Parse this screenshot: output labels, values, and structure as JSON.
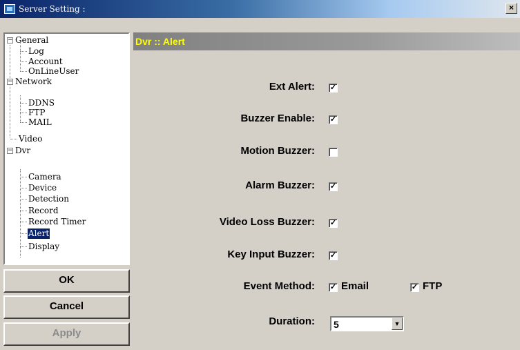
{
  "window": {
    "title": "Server Setting :",
    "close_label": "×"
  },
  "tree": {
    "nodes": {
      "general": {
        "label": "General",
        "expander": "−"
      },
      "log": {
        "label": "Log"
      },
      "account": {
        "label": "Account"
      },
      "onlineuser": {
        "label": "OnLineUser"
      },
      "network": {
        "label": "Network",
        "expander": "−"
      },
      "ddns": {
        "label": "DDNS"
      },
      "ftp": {
        "label": "FTP"
      },
      "mail": {
        "label": "MAIL"
      },
      "video": {
        "label": "Video"
      },
      "dvr": {
        "label": "Dvr",
        "expander": "−"
      },
      "camera": {
        "label": "Camera"
      },
      "device": {
        "label": "Device"
      },
      "detection": {
        "label": "Detection"
      },
      "record": {
        "label": "Record"
      },
      "recordtimer": {
        "label": "Record Timer"
      },
      "alert": {
        "label": "Alert",
        "selected": true
      },
      "display": {
        "label": "Display"
      }
    }
  },
  "buttons": {
    "ok": "OK",
    "cancel": "Cancel",
    "apply": "Apply"
  },
  "panel": {
    "title": "Dvr :: Alert",
    "ext_alert": {
      "label": "Ext Alert:",
      "checked": true
    },
    "buzzer_enable": {
      "label": "Buzzer Enable:",
      "checked": true
    },
    "motion_buzzer": {
      "label": "Motion Buzzer:",
      "checked": false
    },
    "alarm_buzzer": {
      "label": "Alarm Buzzer:",
      "checked": true
    },
    "video_loss_buzzer": {
      "label": "Video Loss Buzzer:",
      "checked": true
    },
    "key_input_buzzer": {
      "label": "Key Input Buzzer:",
      "checked": true
    },
    "event_method": {
      "label": "Event Method:",
      "email": {
        "label": "Email",
        "checked": true
      },
      "ftp": {
        "label": "FTP",
        "checked": true
      }
    },
    "duration": {
      "label": "Duration:",
      "value": "5"
    }
  },
  "check_mark": "✓",
  "dropdown_arrow": "▼",
  "colors": {
    "titlebar": "#0a246a",
    "selection": "#0a246a",
    "header_text": "#ffff00",
    "header_bg": "#808080"
  }
}
